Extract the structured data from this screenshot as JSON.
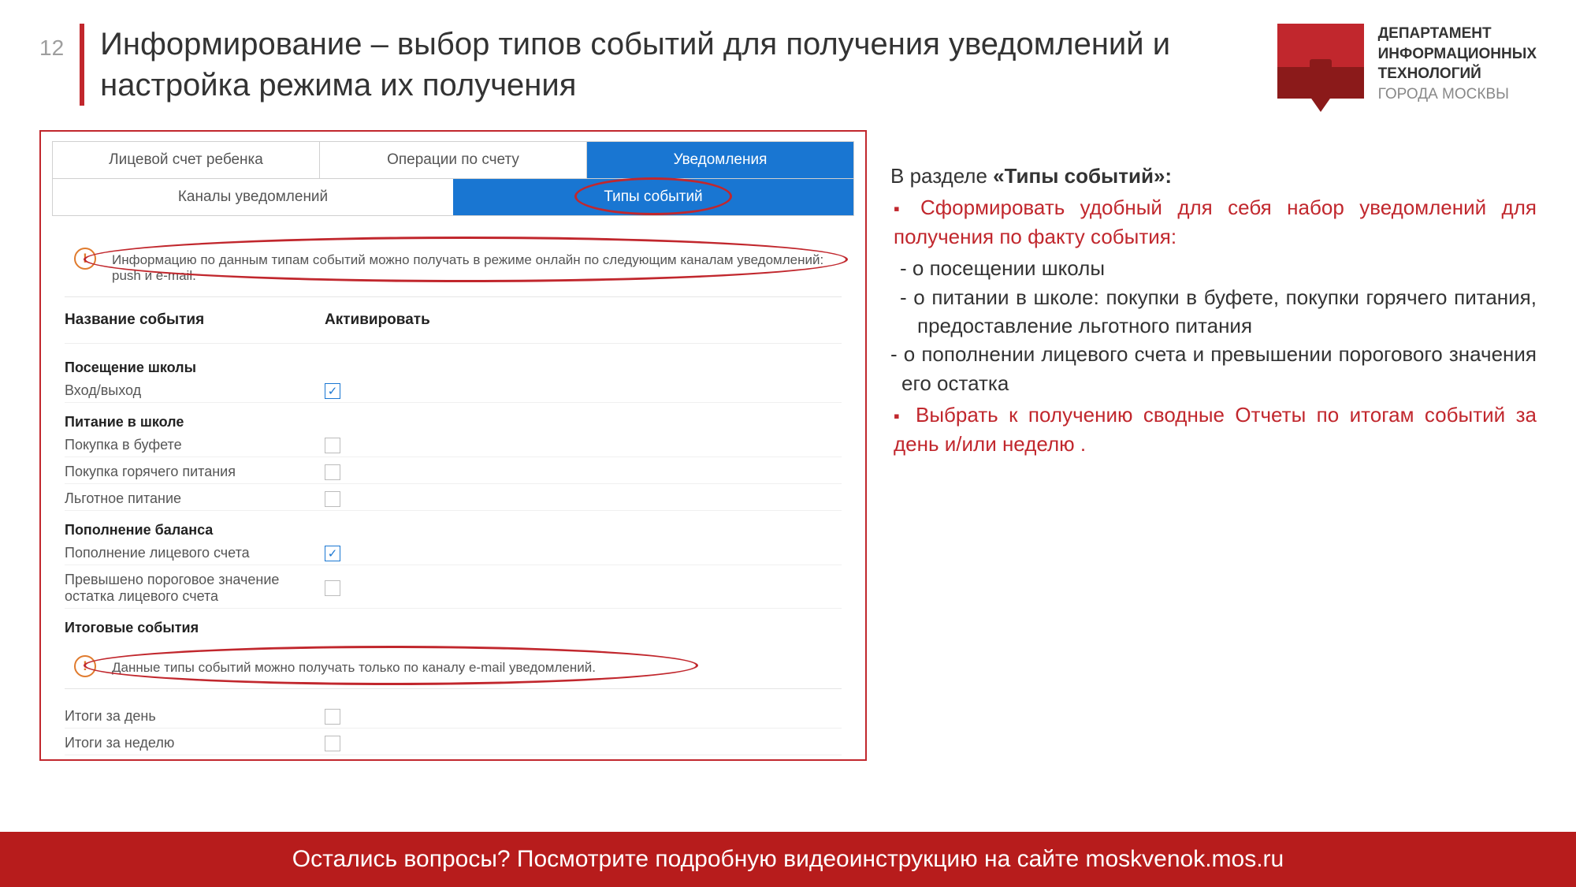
{
  "page_number": "12",
  "title": "Информирование – выбор типов событий для получения уведомлений и настройка режима их получения",
  "logo": {
    "l1": "ДЕПАРТАМЕНТ",
    "l2": "ИНФОРМАЦИОННЫХ",
    "l3": "ТЕХНОЛОГИЙ",
    "l4": "ГОРОДА МОСКВЫ"
  },
  "tabs": {
    "t1": "Лицевой счет ребенка",
    "t2": "Операции по счету",
    "t3": "Уведомления"
  },
  "subtabs": {
    "s1": "Каналы уведомлений",
    "s2": "Типы событий"
  },
  "info1": "Информацию по данным типам событий можно получать в режиме онлайн по следующим каналам уведомлений: push и e-mail.",
  "table_headers": {
    "name": "Название события",
    "activate": "Активировать"
  },
  "sections": {
    "school": "Посещение школы",
    "school_item1": "Вход/выход",
    "meal": "Питание в школе",
    "meal_item1": "Покупка в буфете",
    "meal_item2": "Покупка горячего питания",
    "meal_item3": "Льготное питание",
    "balance": "Пополнение баланса",
    "balance_item1": "Пополнение лицевого счета",
    "balance_item2": "Превышено пороговое значение остатка лицевого счета",
    "summary": "Итоговые события"
  },
  "info2": "Данные типы событий можно получать только по каналу e-mail уведомлений.",
  "summary_items": {
    "day": "Итоги за день",
    "week": "Итоги за неделю"
  },
  "checks": {
    "school1": true,
    "meal1": false,
    "meal2": false,
    "meal3": false,
    "bal1": true,
    "bal2": false,
    "day": false,
    "week": false
  },
  "explain": {
    "lead_prefix": "В разделе ",
    "lead_bold": "«Типы событий»:",
    "bullet1": "Сформировать удобный для себя набор уведомлений для получения по факту события:",
    "dash1": "о посещении школы",
    "dash2": "о питании в школе: покупки в буфете, покупки горячего питания, предоставление льготного питания",
    "dash3": "о пополнении лицевого счета и превышении порогового значения его остатка",
    "bullet2": "Выбрать к получению сводные Отчеты по итогам событий за день и/или неделю ."
  },
  "footer": "Остались вопросы? Посмотрите подробную видеоинструкцию на сайте moskvenok.mos.ru"
}
